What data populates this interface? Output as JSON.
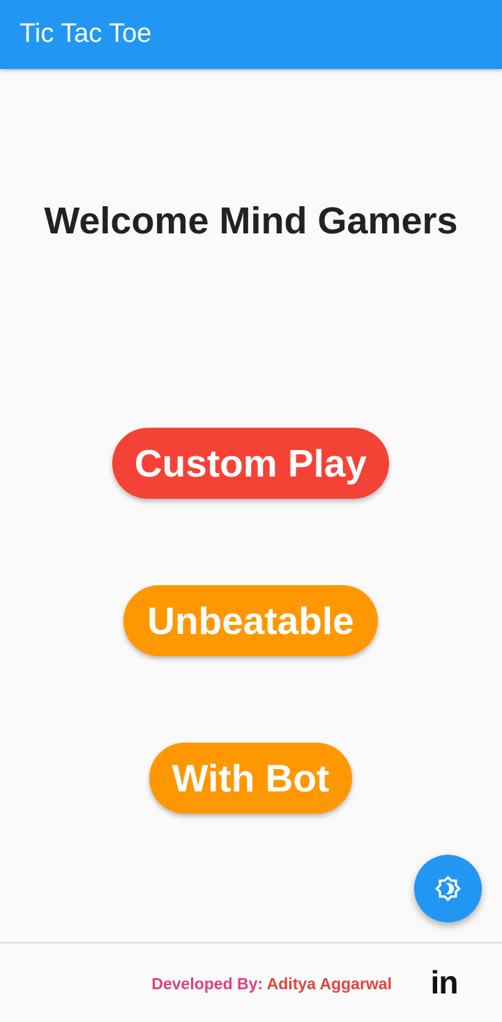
{
  "appbar": {
    "title": "Tic Tac Toe",
    "color": "#2196f3"
  },
  "main": {
    "welcome_text": "Welcome Mind Gamers",
    "buttons": [
      {
        "label": "Custom Play",
        "color": "#f44336"
      },
      {
        "label": "Unbeatable",
        "color": "#ff9800"
      },
      {
        "label": "With Bot",
        "color": "#ff9800"
      }
    ]
  },
  "fab": {
    "icon": "brightness-theme-icon",
    "color": "#2196f3"
  },
  "footer": {
    "developed_by_label": "Developed By:",
    "developer_name": "Aditya Aggarwal",
    "linkedin_icon": "linkedin-icon",
    "linkedin_text": "in"
  }
}
